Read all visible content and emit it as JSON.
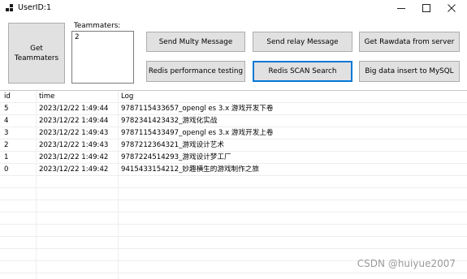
{
  "window": {
    "title": "UserID:1",
    "minimize_icon": "minimize-icon",
    "maximize_icon": "maximize-icon",
    "close_icon": "close-icon"
  },
  "controls": {
    "get_teammaters": "Get Teammaters",
    "teammaters_label": "Teammaters:",
    "teammaters_value": "2",
    "buttons": [
      "Send Multy Message",
      "Send relay Message",
      "Get Rawdata from server",
      "Redis performance testing",
      "Redis SCAN Search",
      "Big data insert to MySQL"
    ]
  },
  "grid": {
    "columns": [
      "id",
      "time",
      "Log"
    ],
    "rows": [
      {
        "id": "5",
        "time": "2023/12/22 1:49:44",
        "log": "9787115433657_opengl es 3.x 游戏开发下卷"
      },
      {
        "id": "4",
        "time": "2023/12/22 1:49:44",
        "log": "9782341423432_游戏化实战"
      },
      {
        "id": "3",
        "time": "2023/12/22 1:49:43",
        "log": "9787115433497_opengl es 3.x 游戏开发上卷"
      },
      {
        "id": "2",
        "time": "2023/12/22 1:49:43",
        "log": "9787212364321_游戏设计艺术"
      },
      {
        "id": "1",
        "time": "2023/12/22 1:49:42",
        "log": "9787224514293_游戏设计梦工厂"
      },
      {
        "id": "0",
        "time": "2023/12/22 1:49:42",
        "log": "9415433154212_妙趣横生的游戏制作之旅"
      }
    ]
  },
  "watermark": "CSDN @huiyue2007"
}
